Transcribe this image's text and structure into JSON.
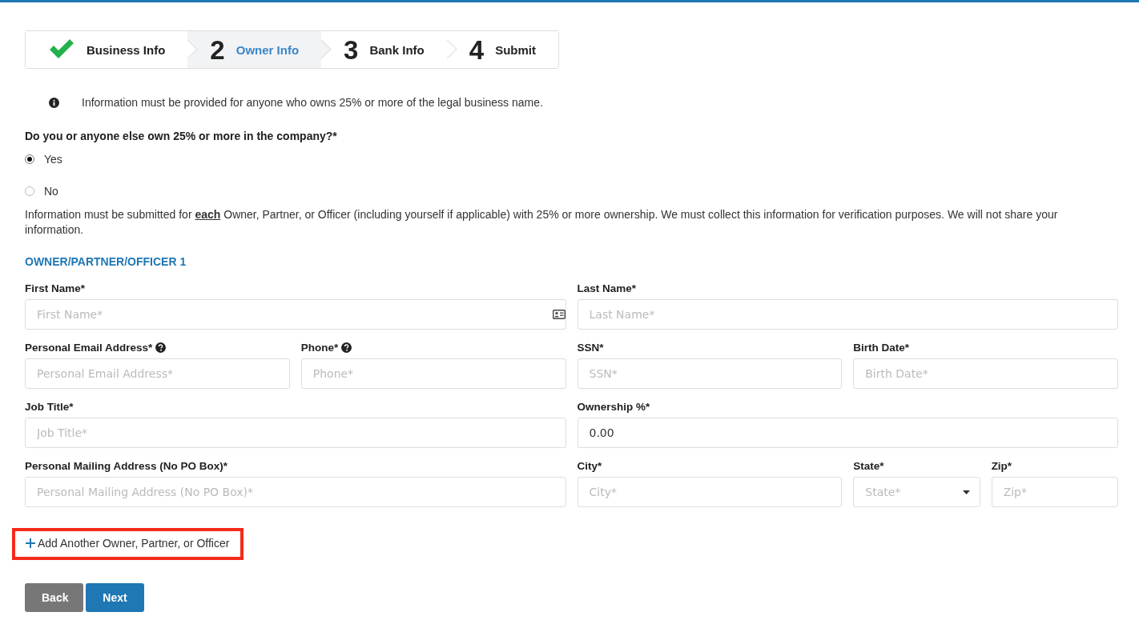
{
  "steps": [
    {
      "label": "Business Info",
      "done": true,
      "selected": false
    },
    {
      "number": "2",
      "label": "Owner Info",
      "done": false,
      "selected": true
    },
    {
      "number": "3",
      "label": "Bank Info",
      "done": false,
      "selected": false
    },
    {
      "number": "4",
      "label": "Submit",
      "done": false,
      "selected": false
    }
  ],
  "info_note": "Information must be provided for anyone who owns 25% or more of the legal business name.",
  "question": {
    "label": "Do you or anyone else own 25% or more in the company?*",
    "options": [
      {
        "label": "Yes",
        "selected": true
      },
      {
        "label": "No",
        "selected": false
      }
    ]
  },
  "notice": "Information must be submitted for **each** Owner, Partner, or Officer (including yourself if applicable) with 25% or more ownership. We must collect this information for verification purposes. We will not share your information.",
  "section_title": "OWNER/PARTNER/OFFICER 1",
  "field_rows": [
    [
      {
        "label": "First Name*",
        "placeholder": "First Name*",
        "kind": "text",
        "card_icon": true,
        "help": false
      },
      {
        "label": "Last Name*",
        "placeholder": "Last Name*",
        "kind": "text",
        "card_icon": false,
        "help": false
      }
    ],
    [
      {
        "label": "Personal Email Address*",
        "placeholder": "Personal Email Address*",
        "kind": "text",
        "card_icon": false,
        "help": true
      },
      {
        "label": "Phone*",
        "placeholder": "Phone*",
        "kind": "text",
        "card_icon": false,
        "help": true
      },
      {
        "label": "SSN*",
        "placeholder": "SSN*",
        "kind": "text",
        "card_icon": false,
        "help": false
      },
      {
        "label": "Birth Date*",
        "placeholder": "Birth Date*",
        "kind": "text",
        "card_icon": false,
        "help": false
      }
    ],
    [
      {
        "label": "Job Title*",
        "placeholder": "Job Title*",
        "kind": "text",
        "card_icon": false,
        "help": false
      },
      {
        "label": "Ownership %*",
        "value": "0.00",
        "kind": "text",
        "card_icon": false,
        "help": false
      }
    ],
    [
      {
        "label": "Personal Mailing Address (No PO Box)*",
        "placeholder": "Personal Mailing Address (No PO Box)*",
        "kind": "text",
        "card_icon": false,
        "help": false
      },
      {
        "label": "City*",
        "placeholder": "City*",
        "kind": "text",
        "card_icon": false,
        "help": false
      },
      {
        "label": "State*",
        "placeholder": "State*",
        "kind": "select",
        "help": false
      },
      {
        "label": "Zip*",
        "placeholder": "Zip*",
        "kind": "text",
        "card_icon": false,
        "help": false
      }
    ]
  ],
  "add_link": {
    "label": "Add Another Owner, Partner, or Officer",
    "highlighted": true
  },
  "buttons": [
    {
      "label": "Back",
      "kind": "secondary"
    },
    {
      "label": "Next",
      "kind": "primary"
    }
  ]
}
